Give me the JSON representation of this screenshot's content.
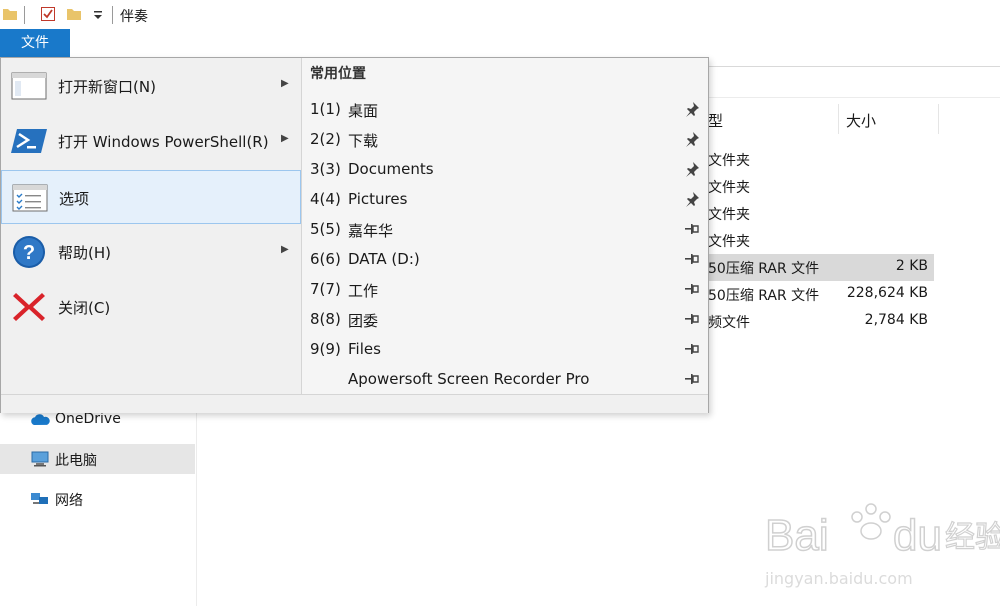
{
  "titlebar": {
    "title": "伴奏"
  },
  "file_tab": {
    "label": "文件"
  },
  "file_menu": {
    "items": [
      {
        "label": "打开新窗口(N)",
        "submenu": true
      },
      {
        "label": "打开 Windows PowerShell(R)",
        "submenu": true
      },
      {
        "label": "选项",
        "submenu": false,
        "highlighted": true
      },
      {
        "label": "帮助(H)",
        "submenu": true
      },
      {
        "label": "关闭(C)",
        "submenu": false
      }
    ],
    "recent": {
      "header": "常用位置",
      "items": [
        {
          "num": "1(1)",
          "name": "桌面",
          "pinned": true
        },
        {
          "num": "2(2)",
          "name": "下载",
          "pinned": true
        },
        {
          "num": "3(3)",
          "name": "Documents",
          "pinned": true
        },
        {
          "num": "4(4)",
          "name": "Pictures",
          "pinned": true
        },
        {
          "num": "5(5)",
          "name": "嘉年华",
          "pinned": false
        },
        {
          "num": "6(6)",
          "name": "DATA (D:)",
          "pinned": false
        },
        {
          "num": "7(7)",
          "name": "工作",
          "pinned": false
        },
        {
          "num": "8(8)",
          "name": "团委",
          "pinned": false
        },
        {
          "num": "9(9)",
          "name": "Files",
          "pinned": false
        },
        {
          "num": "",
          "name": "Apowersoft Screen Recorder Pro",
          "pinned": false
        }
      ]
    }
  },
  "file_list": {
    "columns": {
      "type": "型",
      "size": "大小"
    },
    "rows": [
      {
        "type": "文件夹",
        "size": ""
      },
      {
        "type": "文件夹",
        "size": ""
      },
      {
        "type": "文件夹",
        "size": ""
      },
      {
        "type": "文件夹",
        "size": ""
      },
      {
        "type": "50压缩 RAR 文件",
        "size": "2 KB",
        "selected": true
      },
      {
        "type": "50压缩 RAR 文件",
        "size": "228,624 KB"
      },
      {
        "type": "频文件",
        "size": "2,784 KB"
      }
    ]
  },
  "nav_pane": {
    "items": [
      {
        "label": "OneDrive",
        "icon": "onedrive-icon"
      },
      {
        "label": "此电脑",
        "icon": "this-pc-icon",
        "selected": true
      },
      {
        "label": "网络",
        "icon": "network-icon"
      }
    ]
  },
  "watermark": {
    "text": "jingyan.baidu.com",
    "logo_text": "Bai du 经验"
  },
  "colors": {
    "accent": "#1979ca",
    "menu_bg": "#f0f0f0",
    "highlight": "#e5f0fb",
    "selection": "#d9d9d9"
  }
}
